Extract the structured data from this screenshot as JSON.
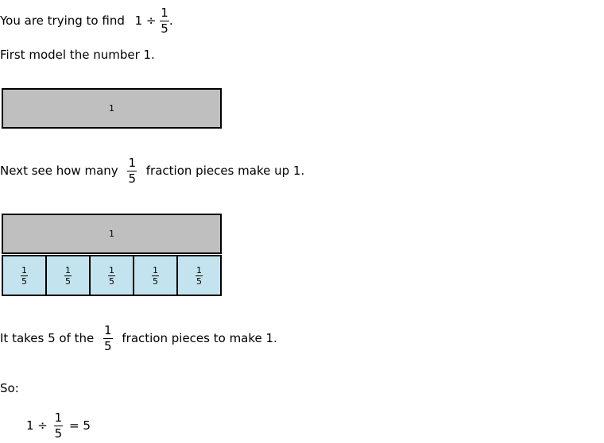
{
  "intro": {
    "prefix": "You are trying to find",
    "expr_left": "1 ÷",
    "frac_num": "1",
    "frac_den": "5",
    "suffix": "."
  },
  "step1": {
    "text": "First model the number 1."
  },
  "model1": {
    "whole_label": "1"
  },
  "step2": {
    "prefix": "Next see how many",
    "frac_num": "1",
    "frac_den": "5",
    "suffix": "fraction pieces make up 1."
  },
  "model2": {
    "whole_label": "1",
    "pieces": [
      {
        "num": "1",
        "den": "5"
      },
      {
        "num": "1",
        "den": "5"
      },
      {
        "num": "1",
        "den": "5"
      },
      {
        "num": "1",
        "den": "5"
      },
      {
        "num": "1",
        "den": "5"
      }
    ]
  },
  "step3": {
    "prefix": "It takes 5 of the",
    "frac_num": "1",
    "frac_den": "5",
    "suffix": "fraction pieces to make 1."
  },
  "so": {
    "text": "So:"
  },
  "equation": {
    "left": "1 ÷",
    "frac_num": "1",
    "frac_den": "5",
    "right": "= 5"
  },
  "colors": {
    "whole_fill": "#bfbfbf",
    "piece_fill": "#c3e3ee"
  }
}
